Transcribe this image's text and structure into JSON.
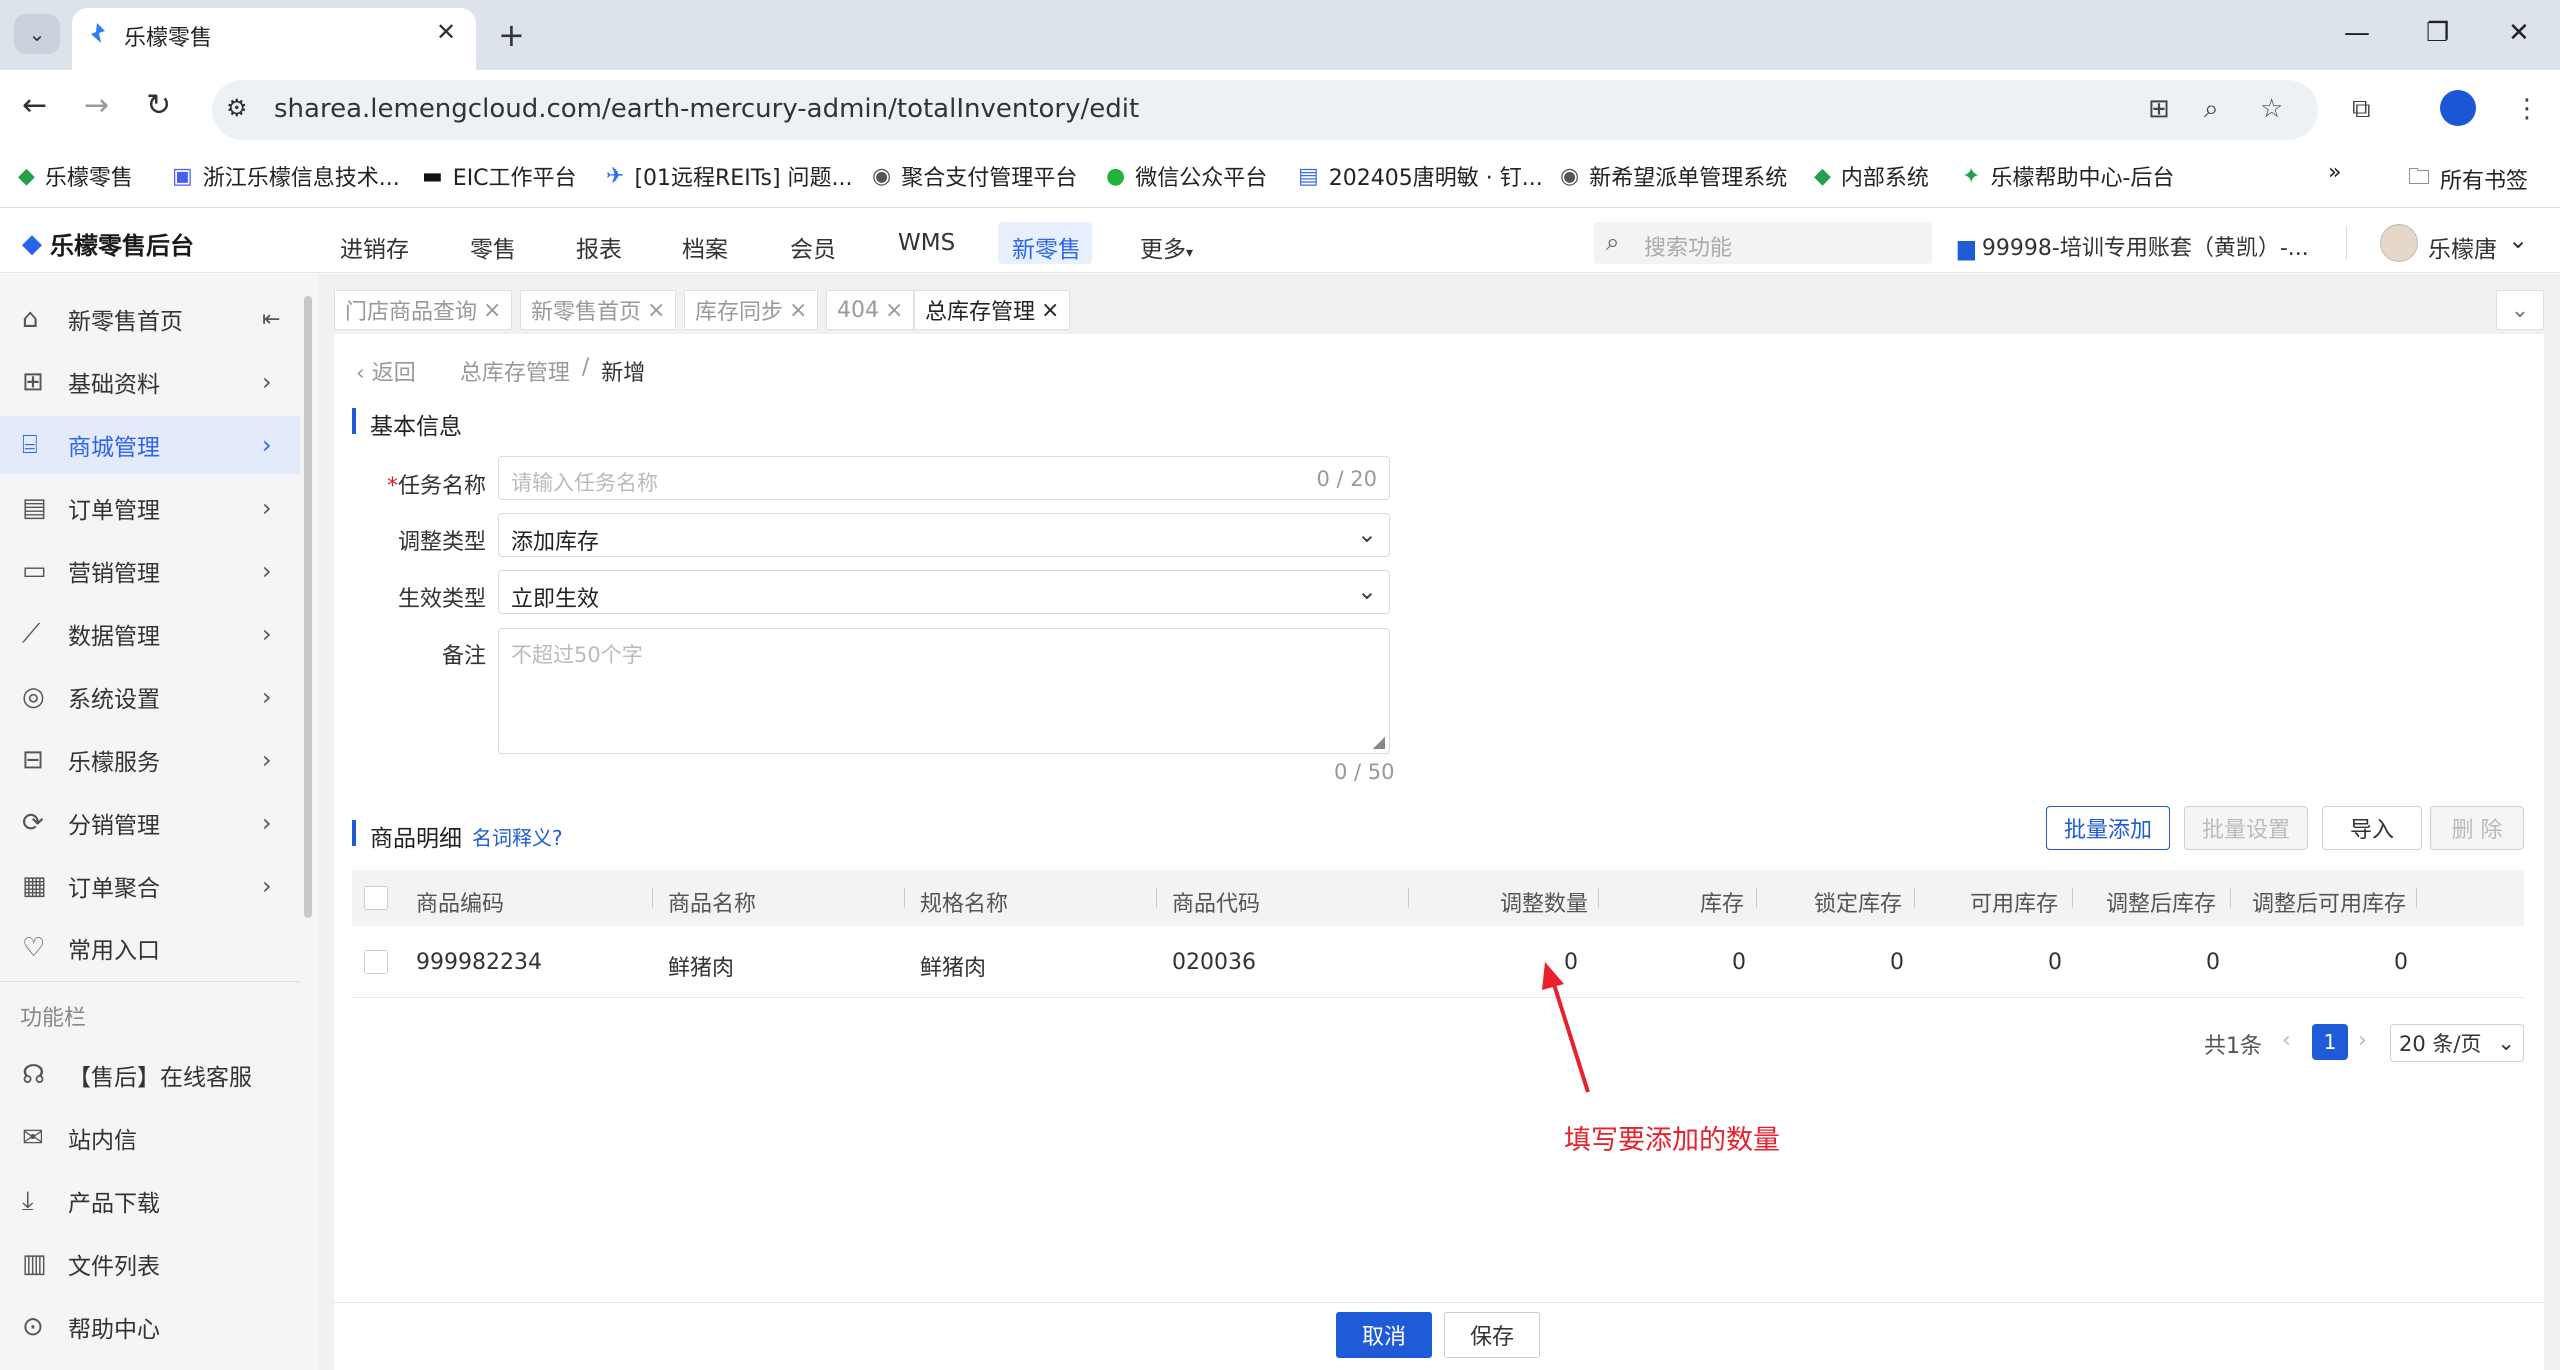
{
  "browser": {
    "tab_title": "乐檬零售",
    "url": "sharea.lemengcloud.com/earth-mercury-admin/totalInventory/edit",
    "bookmarks": [
      "乐檬零售",
      "浙江乐檬信息技术...",
      "EIC工作平台",
      "[01远程REITs] 问题...",
      "聚合支付管理平台",
      "微信公众平台",
      "202405唐明敏 · 钉...",
      "新希望派单管理系统",
      "内部系统",
      "乐檬帮助中心-后台"
    ],
    "bookmarks_more": "»",
    "all_bookmarks": "所有书签"
  },
  "header": {
    "logo": "乐檬零售后台",
    "nav": [
      "进销存",
      "零售",
      "报表",
      "档案",
      "会员",
      "WMS",
      "新零售",
      "更多"
    ],
    "search_placeholder": "搜索功能",
    "account": "99998-培训专用账套（黄凯）-...",
    "username": "乐檬唐"
  },
  "sidebar": {
    "items": [
      {
        "label": "新零售首页",
        "icon": "home-icon"
      },
      {
        "label": "基础资料",
        "icon": "grid-icon"
      },
      {
        "label": "商城管理",
        "icon": "store-icon"
      },
      {
        "label": "订单管理",
        "icon": "document-icon"
      },
      {
        "label": "营销管理",
        "icon": "chart-screen-icon"
      },
      {
        "label": "数据管理",
        "icon": "line-chart-icon"
      },
      {
        "label": "系统设置",
        "icon": "settings-icon"
      },
      {
        "label": "乐檬服务",
        "icon": "briefcase-icon"
      },
      {
        "label": "分销管理",
        "icon": "share-icon"
      },
      {
        "label": "订单聚合",
        "icon": "clipboard-icon"
      },
      {
        "label": "常用入口",
        "icon": "heart-icon"
      }
    ],
    "func_header": "功能栏",
    "func_items": [
      {
        "label": "【售后】在线客服",
        "icon": "headset-icon"
      },
      {
        "label": "站内信",
        "icon": "mail-icon"
      },
      {
        "label": "产品下载",
        "icon": "download-icon"
      },
      {
        "label": "文件列表",
        "icon": "file-chart-icon"
      },
      {
        "label": "帮助中心",
        "icon": "help-icon"
      }
    ]
  },
  "page_tabs": [
    "门店商品查询",
    "新零售首页",
    "库存同步",
    "404",
    "总库存管理"
  ],
  "breadcrumb": {
    "back": "返回",
    "parent": "总库存管理",
    "sep": "/",
    "current": "新增"
  },
  "basic": {
    "title": "基本信息",
    "task_label": "任务名称",
    "task_required": "*",
    "task_placeholder": "请输入任务名称",
    "task_count": "0 / 20",
    "adjust_label": "调整类型",
    "adjust_value": "添加库存",
    "effect_label": "生效类型",
    "effect_value": "立即生效",
    "remark_label": "备注",
    "remark_placeholder": "不超过50个字",
    "remark_count": "0 / 50"
  },
  "detail": {
    "title": "商品明细",
    "glossary": "名词释义?",
    "buttons": {
      "batch_add": "批量添加",
      "batch_set": "批量设置",
      "import": "导入",
      "delete": "删 除"
    },
    "columns": [
      "商品编码",
      "商品名称",
      "规格名称",
      "商品代码",
      "调整数量",
      "库存",
      "锁定库存",
      "可用库存",
      "调整后库存",
      "调整后可用库存"
    ],
    "rows": [
      {
        "code": "999982234",
        "name": "鲜猪肉",
        "spec": "鲜猪肉",
        "product_code": "020036",
        "adjust_qty": "0",
        "stock": "0",
        "locked": "0",
        "available": "0",
        "after_stock": "0",
        "after_available": "0"
      }
    ]
  },
  "pagination": {
    "total": "共1条",
    "current": "1",
    "page_size": "20 条/页"
  },
  "annotation": "填写要添加的数量",
  "footer": {
    "cancel": "取消",
    "save": "保存"
  },
  "colors": {
    "accent": "#1f5bd6",
    "annotation": "#e8212c",
    "sidebar_active_bg": "#e3ebfb"
  }
}
